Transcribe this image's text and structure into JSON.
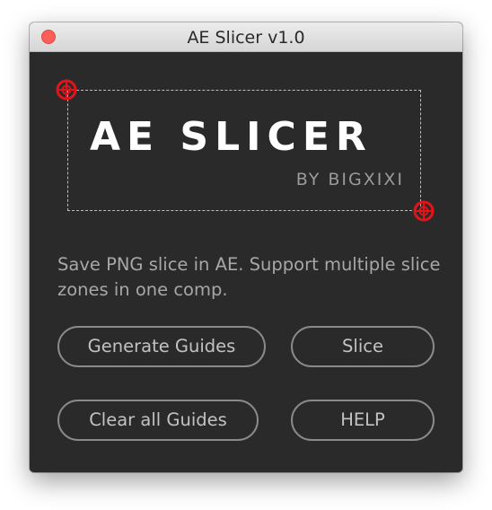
{
  "window": {
    "title": "AE Slicer v1.0"
  },
  "logo": {
    "main": "AE SLICER",
    "sub": "BY BIGXIXI"
  },
  "description": "Save PNG slice in AE. Support multiple slice zones in one comp.",
  "buttons": {
    "generate_guides": "Generate Guides",
    "slice": "Slice",
    "clear_all_guides": "Clear all Guides",
    "help": "HELP"
  },
  "colors": {
    "panel_bg": "#2a2a2a",
    "close_button": "#fc5f57",
    "handle_red": "#e4131a",
    "text_gray": "#a7a7a7",
    "button_border": "#8a8a8a"
  },
  "icons": {
    "close": "close-icon",
    "handle": "crosshair-handle-icon"
  }
}
